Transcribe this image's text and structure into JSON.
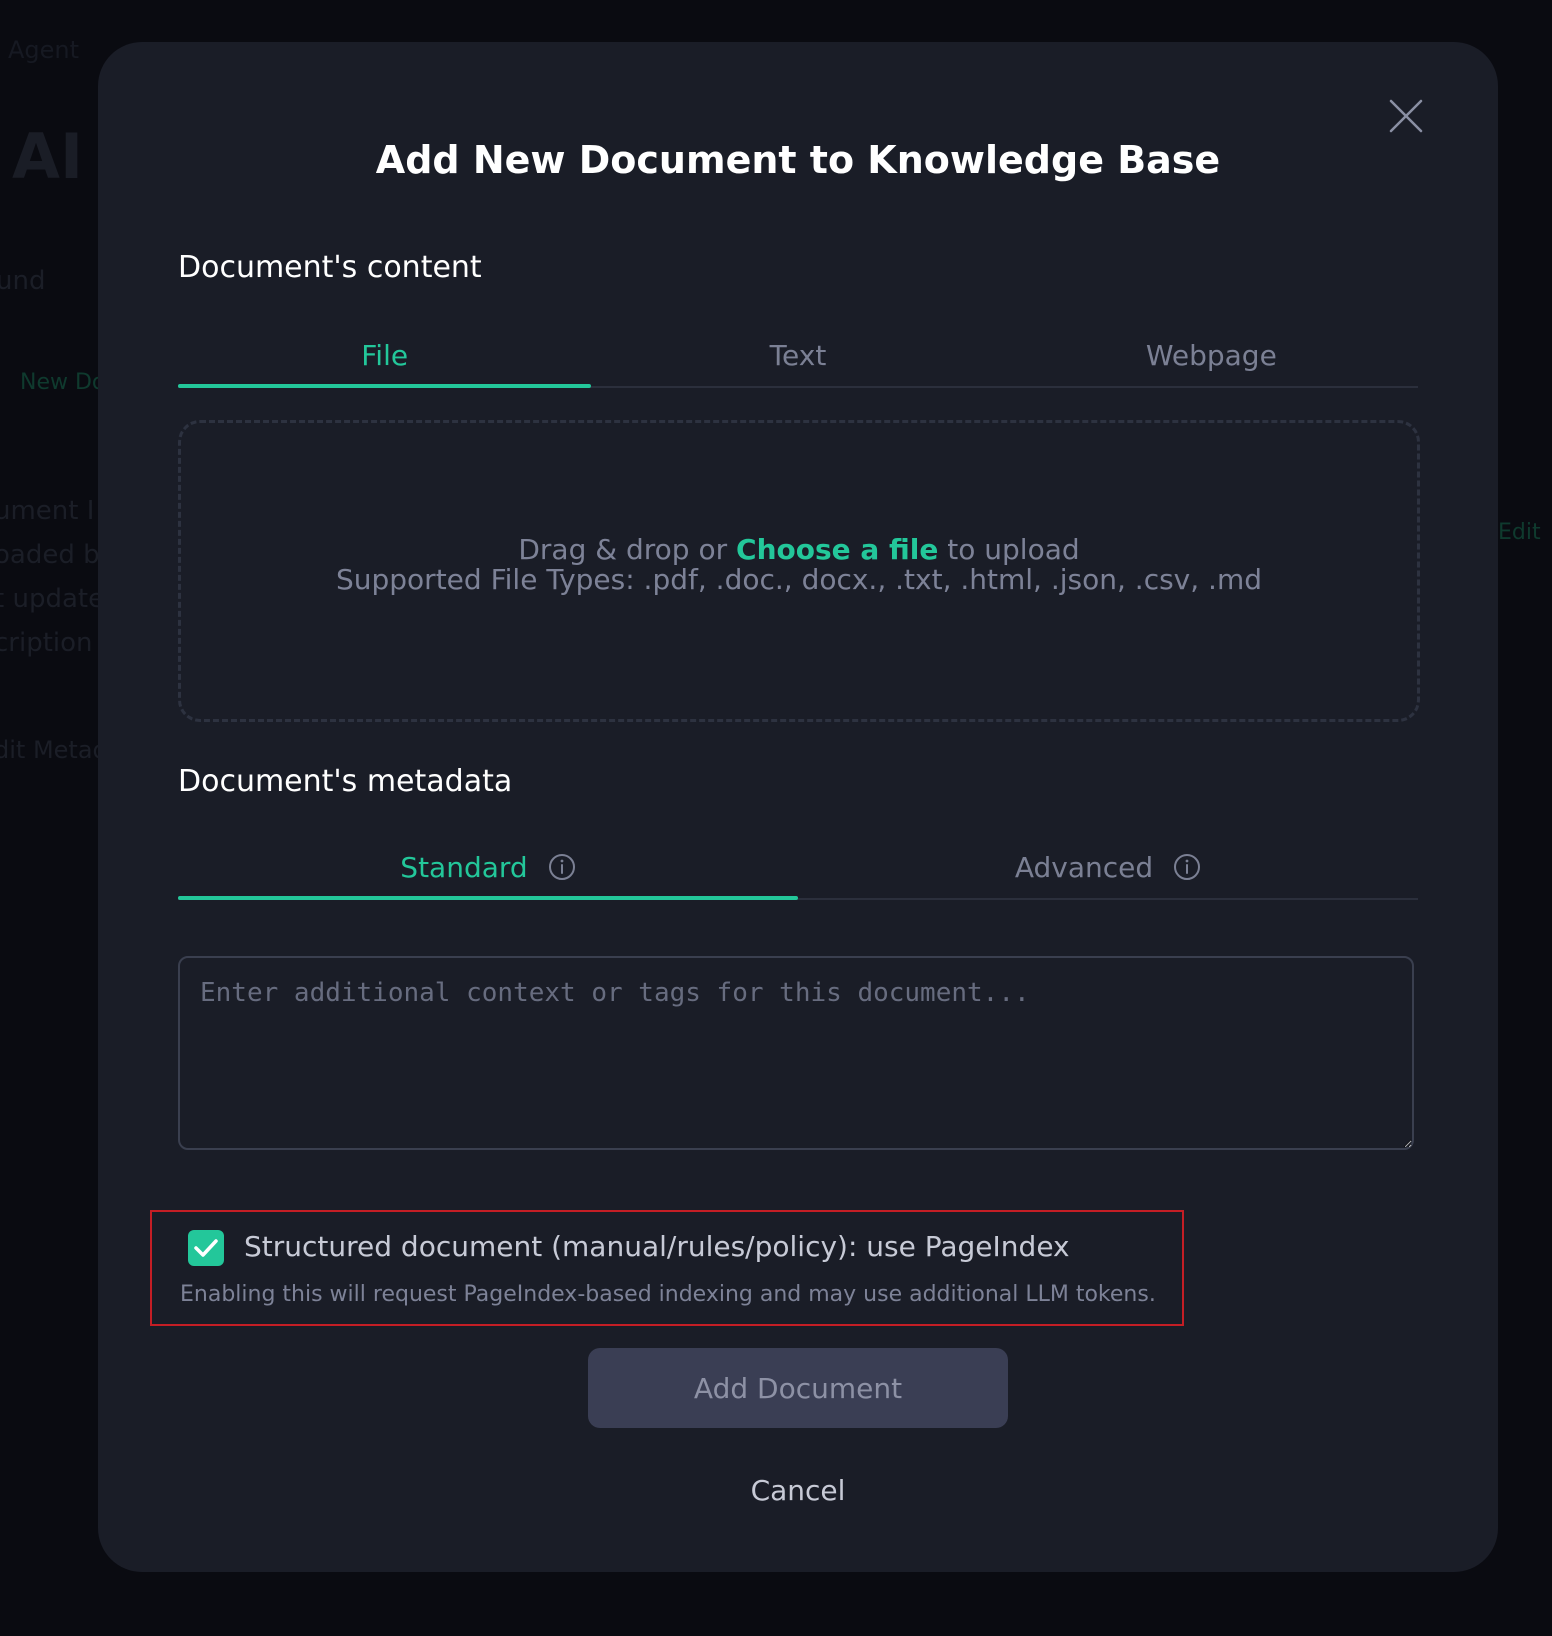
{
  "background": {
    "breadcrumb": "Agent",
    "title": "AI A",
    "subtitle": "und",
    "link": "New Do",
    "lines": [
      "ument I",
      "oaded b",
      "t update",
      "cription"
    ],
    "edit_metadata": "dit Metad",
    "edit": "Edit"
  },
  "modal": {
    "title": "Add New Document to Knowledge Base",
    "content_section": {
      "label": "Document's content",
      "tabs": [
        {
          "label": "File",
          "active": true
        },
        {
          "label": "Text",
          "active": false
        },
        {
          "label": "Webpage",
          "active": false
        }
      ],
      "dropzone": {
        "prefix": "Drag & drop or",
        "link": "Choose a file",
        "suffix": "to upload",
        "supported": "Supported File Types: .pdf, .doc., docx., .txt, .html, .json, .csv, .md"
      }
    },
    "metadata_section": {
      "label": "Document's metadata",
      "tabs": [
        {
          "label": "Standard",
          "active": true
        },
        {
          "label": "Advanced",
          "active": false
        }
      ],
      "input": {
        "value": "",
        "placeholder": "Enter additional context or tags for this document..."
      }
    },
    "pageindex": {
      "checked": true,
      "label": "Structured document (manual/rules/policy): use PageIndex",
      "hint": "Enabling this will request PageIndex-based indexing and may use additional LLM tokens."
    },
    "buttons": {
      "add": "Add Document",
      "cancel": "Cancel"
    }
  },
  "colors": {
    "accent": "#23c79a",
    "modal_bg": "#1a1d27",
    "highlight_border": "#c41e25",
    "button_bg": "#3a3e54"
  },
  "icons": {
    "close": "close-icon",
    "info": "info-icon",
    "check": "check-icon"
  }
}
